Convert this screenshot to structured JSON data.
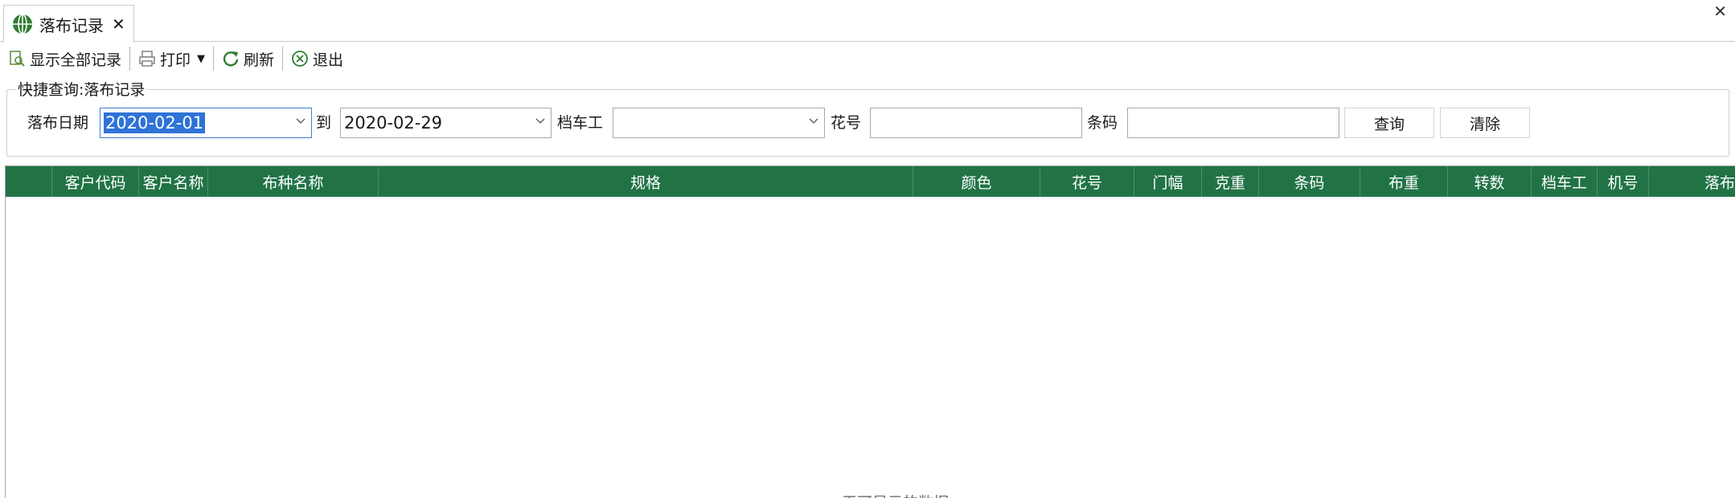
{
  "tab": {
    "label": "落布记录",
    "close": "✕"
  },
  "window": {
    "close": "✕"
  },
  "toolbar": {
    "show_all": "显示全部记录",
    "print": "打印",
    "refresh": "刷新",
    "exit": "退出"
  },
  "query": {
    "title": "快捷查询:落布记录",
    "date_label": "落布日期",
    "date_from": "2020-02-01",
    "to_label": "到",
    "date_to": "2020-02-29",
    "worker_label": "档车工",
    "worker_value": "",
    "pattern_label": "花号",
    "pattern_value": "",
    "barcode_label": "条码",
    "barcode_value": "",
    "search_button": "查询",
    "clear_button": "清除"
  },
  "grid": {
    "columns": [
      "",
      "客户代码",
      "客户名称",
      "布种名称",
      "规格",
      "颜色",
      "花号",
      "门幅",
      "克重",
      "条码",
      "布重",
      "转数",
      "档车工",
      "机号",
      "落布"
    ],
    "empty_text": "无可显示的数据"
  },
  "colors": {
    "header_green": "#217346",
    "selection_blue": "#2f73d8"
  }
}
